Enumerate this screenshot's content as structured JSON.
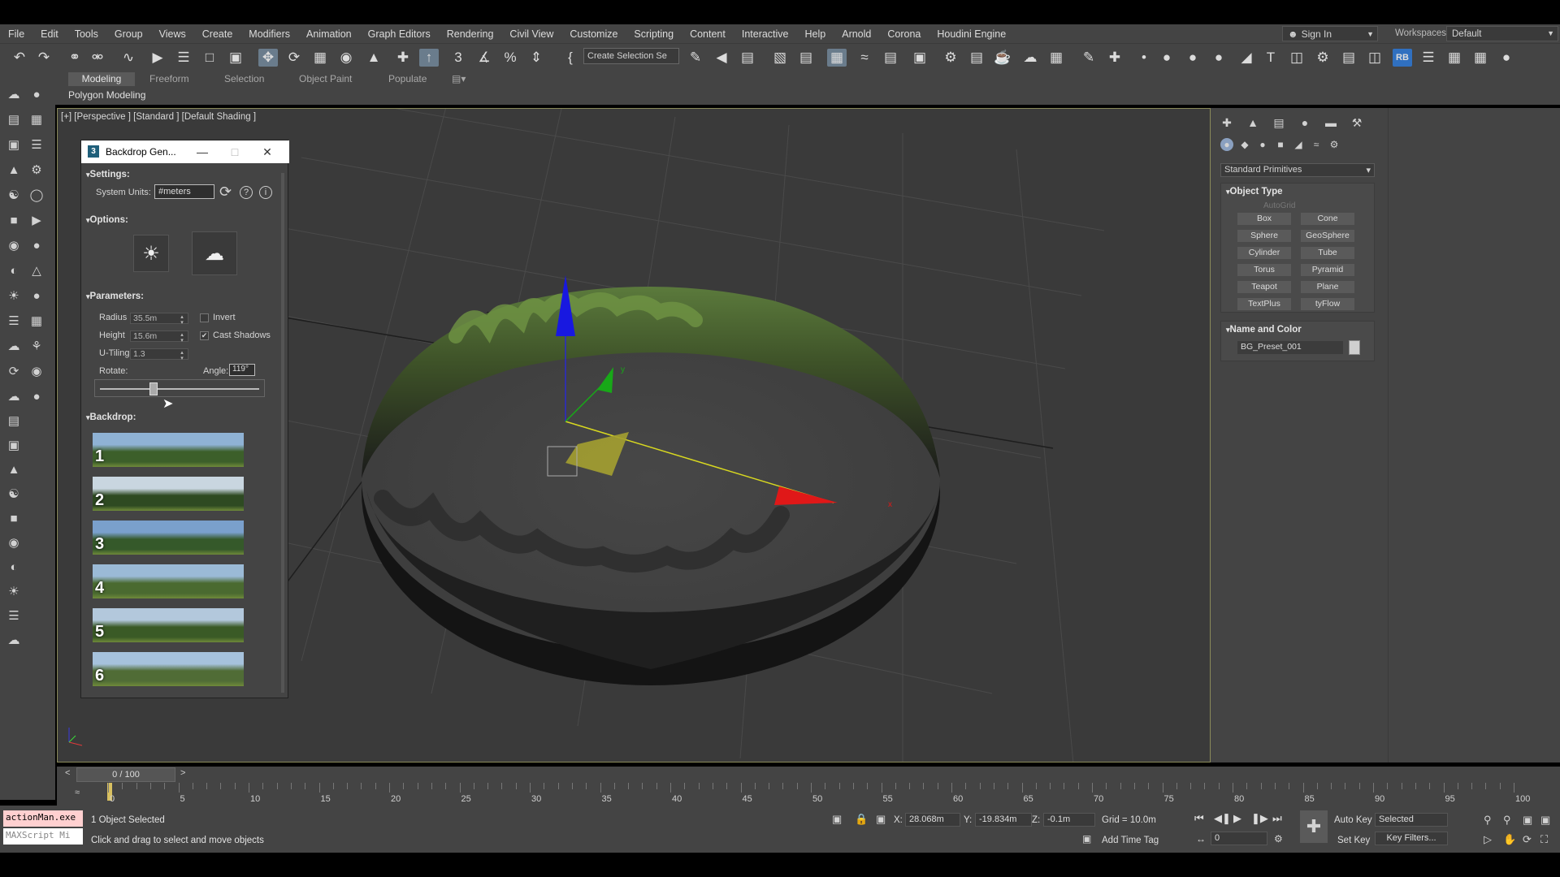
{
  "menubar": {
    "items": [
      "File",
      "Edit",
      "Tools",
      "Group",
      "Views",
      "Create",
      "Modifiers",
      "Animation",
      "Graph Editors",
      "Rendering",
      "Civil View",
      "Customize",
      "Scripting",
      "Content",
      "Interactive",
      "Help",
      "Arnold",
      "Corona",
      "Houdini Engine"
    ],
    "sign_in": "Sign In",
    "workspaces_label": "Workspaces:",
    "workspace_value": "Default"
  },
  "toolbar": {
    "selection_set_placeholder": "Create Selection Se"
  },
  "ribbon": {
    "tabs": [
      "Modeling",
      "Freeform",
      "Selection",
      "Object Paint",
      "Populate"
    ],
    "sub_label": "Polygon Modeling"
  },
  "viewport": {
    "label": "[+] [Perspective ] [Standard ] [Default Shading ]",
    "gizmo_x": "x",
    "gizmo_y": "y"
  },
  "dialog": {
    "title": "Backdrop Gen...",
    "logo": "3",
    "settings_header": "Settings:",
    "system_units_label": "System Units:",
    "system_units_value": "#meters",
    "options_header": "Options:",
    "parameters_header": "Parameters:",
    "radius_label": "Radius",
    "radius_value": "35.5m",
    "height_label": "Height",
    "height_value": "15.6m",
    "utiling_label": "U-Tiling",
    "utiling_value": "1.3",
    "invert_label": "Invert",
    "invert_checked": false,
    "cast_shadows_label": "Cast Shadows",
    "cast_shadows_checked": true,
    "check_mark": "✔",
    "rotate_label": "Rotate:",
    "angle_label": "Angle:",
    "angle_value": "119°",
    "rotate_fraction": 0.33,
    "backdrop_header": "Backdrop:",
    "backdrops": [
      "1",
      "2",
      "3",
      "4",
      "5",
      "6"
    ]
  },
  "command_panel": {
    "dropdown": "Standard Primitives",
    "object_type_header": "Object Type",
    "autogrid": "AutoGrid",
    "buttons": [
      "Box",
      "Cone",
      "Sphere",
      "GeoSphere",
      "Cylinder",
      "Tube",
      "Torus",
      "Pyramid",
      "Teapot",
      "Plane",
      "TextPlus",
      "tyFlow"
    ],
    "name_color_header": "Name and Color",
    "object_name": "BG_Preset_001"
  },
  "timeline": {
    "slider_label": "0 / 100",
    "prev": "<",
    "next": ">",
    "ticks": [
      "0",
      "5",
      "10",
      "15",
      "20",
      "25",
      "30",
      "35",
      "40",
      "45",
      "50",
      "55",
      "60",
      "65",
      "70",
      "75",
      "80",
      "85",
      "90",
      "95",
      "100"
    ]
  },
  "status": {
    "script_line1": "actionMan.exe",
    "script_line2": "MAXScript Mi",
    "selection_info": "1 Object Selected",
    "prompt": "Click and drag to select and move objects",
    "x_label": "X:",
    "x_value": "28.068m",
    "y_label": "Y:",
    "y_value": "-19.834m",
    "z_label": "Z:",
    "z_value": "-0.1m",
    "grid": "Grid = 10.0m",
    "add_time_tag": "Add Time Tag",
    "auto_key": "Auto Key",
    "set_key": "Set Key",
    "selected": "Selected",
    "key_filters": "Key Filters...",
    "frame_value": "0"
  },
  "colors": {
    "ui_bg": "#444444",
    "viewport_bg": "#3a3a3a",
    "active_tool": "#6a7c8c",
    "gizmo_x": "#e01818",
    "gizmo_y": "#18a818",
    "gizmo_z": "#1818e0"
  }
}
